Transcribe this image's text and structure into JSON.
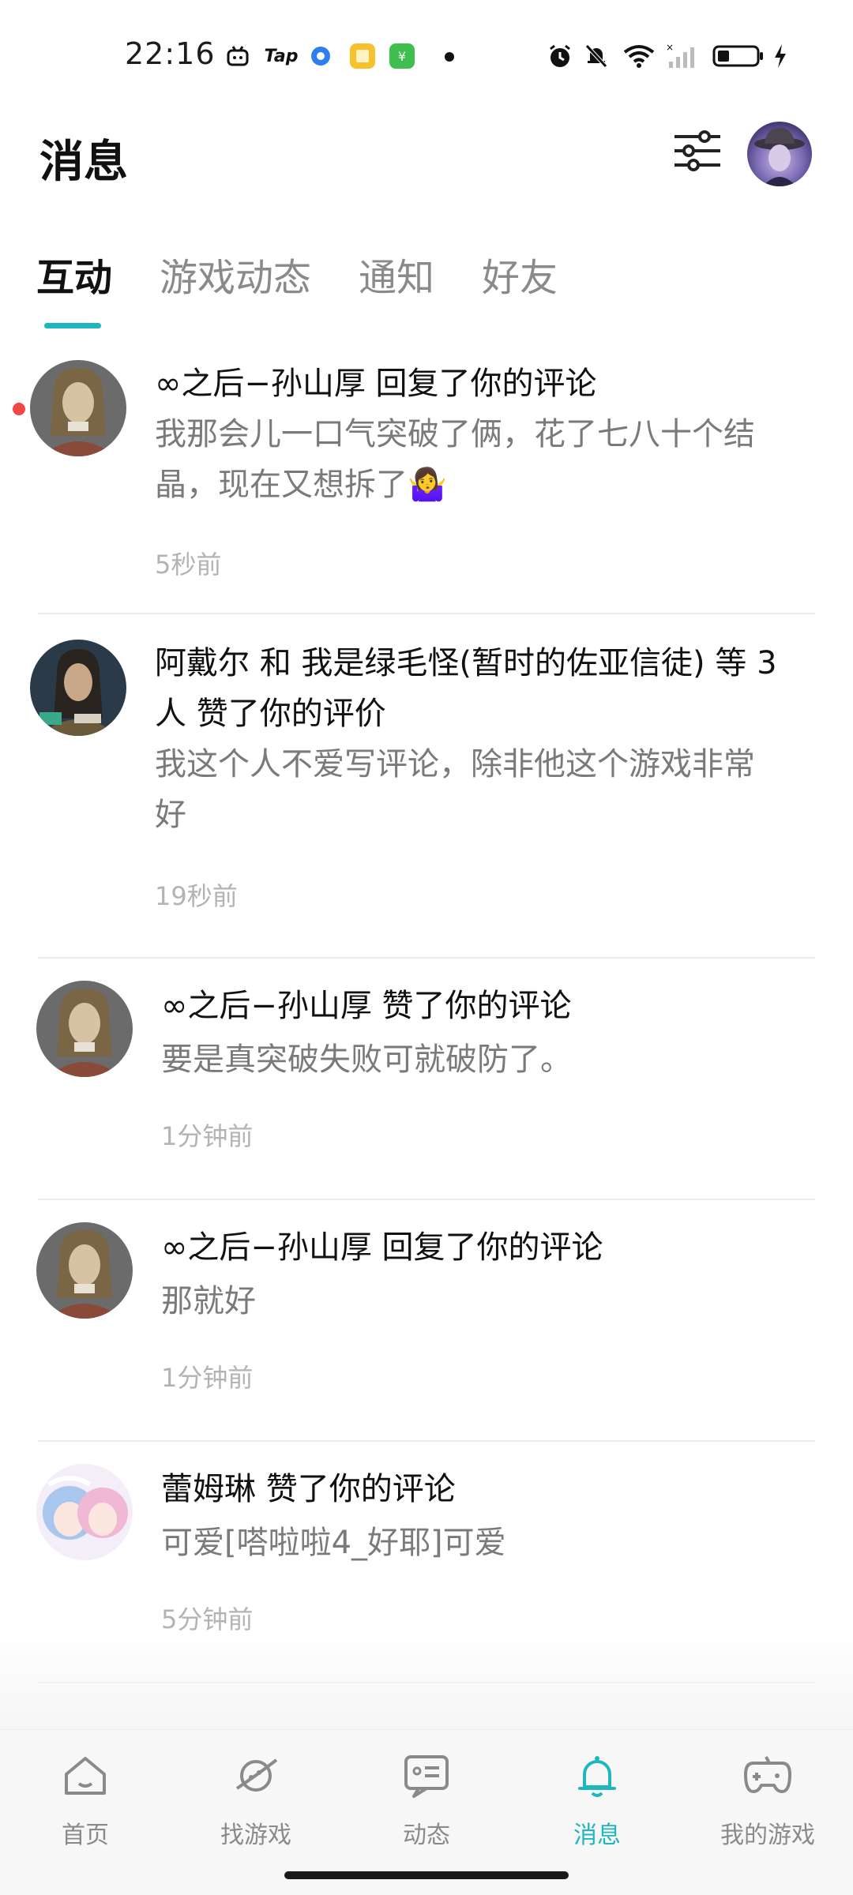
{
  "status_bar": {
    "time": "22:16",
    "left_icons": [
      "bilibili-icon",
      "taptap-icon",
      "circle-app-icon",
      "notes-app-icon",
      "wechat-app-icon"
    ],
    "tap_label": "Tap",
    "right_icons": [
      "alarm-icon",
      "mute-bell-icon",
      "wifi-icon",
      "signal-icon",
      "battery-icon",
      "charging-icon"
    ]
  },
  "header": {
    "title": "消息"
  },
  "tabs": [
    {
      "label": "互动",
      "active": true
    },
    {
      "label": "游戏动态",
      "active": false
    },
    {
      "label": "通知",
      "active": false
    },
    {
      "label": "好友",
      "active": false
    }
  ],
  "messages": [
    {
      "title": "∞之后−孙山厚 回复了你的评论",
      "body_line1": "我那会儿一口气突破了俩，花了七八十个结",
      "body_line2": "晶，现在又想拆了🤷‍♀️",
      "time": "5秒前",
      "unread": true,
      "avatar": "warrior-avatar"
    },
    {
      "title_line1": "阿戴尔 和 我是绿毛怪(暂时的佐亚信徒) 等 3",
      "title_line2": "人 赞了你的评价",
      "body_line1": "我这个人不爱写评论，除非他这个游戏非常",
      "body_line2": "好",
      "time": "19秒前",
      "avatar": "adair-avatar"
    },
    {
      "title": "∞之后−孙山厚 赞了你的评论",
      "body": "要是真突破失败可就破防了。",
      "time": "1分钟前",
      "avatar": "warrior-avatar"
    },
    {
      "title": "∞之后−孙山厚 回复了你的评论",
      "body": "那就好",
      "time": "1分钟前",
      "avatar": "warrior-avatar"
    },
    {
      "title": "蕾姆琳 赞了你的评论",
      "body": "可爱[嗒啦啦4_好耶]可爱",
      "time": "5分钟前",
      "avatar": "anime-girls-avatar"
    }
  ],
  "bottom_nav": [
    {
      "label": "首页",
      "icon": "home-icon",
      "active": false
    },
    {
      "label": "找游戏",
      "icon": "planet-icon",
      "active": false
    },
    {
      "label": "动态",
      "icon": "feed-icon",
      "active": false
    },
    {
      "label": "消息",
      "icon": "bell-icon",
      "active": true
    },
    {
      "label": "我的游戏",
      "icon": "gamepad-icon",
      "active": false
    }
  ],
  "colors": {
    "accent": "#1fb6c0",
    "unread_dot": "#f04848",
    "muted_text": "#7a7a7a",
    "time_text": "#b3b3b3"
  }
}
